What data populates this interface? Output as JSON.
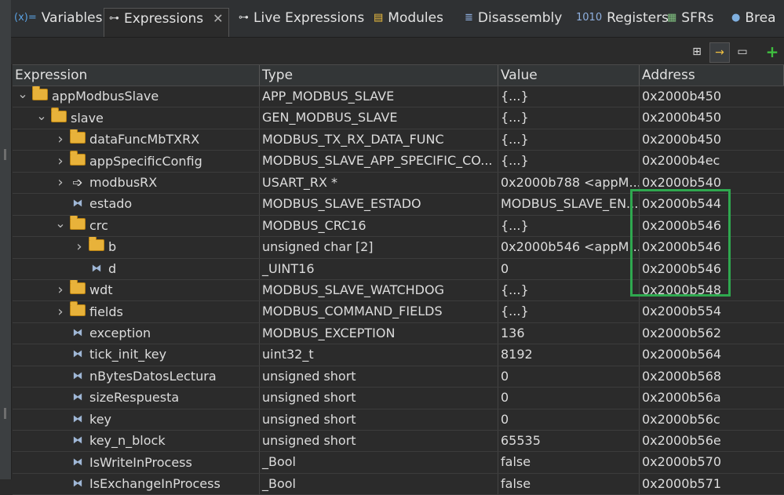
{
  "tabs": [
    {
      "icon": "variables-icon",
      "glyph": "(x)=",
      "label": "Variables",
      "active": false
    },
    {
      "icon": "expressions-icon",
      "glyph": "⊶",
      "label": "Expressions",
      "active": true
    },
    {
      "icon": "live-expressions-icon",
      "glyph": "⊶",
      "label": "Live Expressions",
      "active": false
    },
    {
      "icon": "modules-icon",
      "glyph": "▤",
      "label": "Modules",
      "active": false
    },
    {
      "icon": "disassembly-icon",
      "glyph": "≣",
      "label": "Disassembly",
      "active": false
    },
    {
      "icon": "registers-icon",
      "glyph": "1010",
      "label": "Registers",
      "active": false
    },
    {
      "icon": "sfrs-icon",
      "glyph": "▦",
      "label": "SFRs",
      "active": false
    },
    {
      "icon": "breakpoints-icon",
      "glyph": "●",
      "label": "Brea",
      "active": false
    }
  ],
  "tab_close_glyph": "✕",
  "columns": [
    "Expression",
    "Type",
    "Value",
    "Address"
  ],
  "rows": [
    {
      "indent": 0,
      "twisty": "open",
      "icon": "folder",
      "name": "appModbusSlave",
      "type": "APP_MODBUS_SLAVE",
      "value": "{...}",
      "address": "0x2000b450"
    },
    {
      "indent": 1,
      "twisty": "open",
      "icon": "folder",
      "name": "slave",
      "type": "GEN_MODBUS_SLAVE",
      "value": "{...}",
      "address": "0x2000b450"
    },
    {
      "indent": 2,
      "twisty": "closed",
      "icon": "folder",
      "name": "dataFuncMbTXRX",
      "type": "MODBUS_TX_RX_DATA_FUNC",
      "value": "{...}",
      "address": "0x2000b450"
    },
    {
      "indent": 2,
      "twisty": "closed",
      "icon": "folder",
      "name": "appSpecificConfig",
      "type": "MODBUS_SLAVE_APP_SPECIFIC_CO...",
      "value": "{...}",
      "address": "0x2000b4ec"
    },
    {
      "indent": 2,
      "twisty": "closed",
      "icon": "pointer",
      "name": "modbusRX",
      "type": "USART_RX *",
      "value": "0x2000b788 <appM...",
      "address": "0x2000b540"
    },
    {
      "indent": 2,
      "twisty": "none",
      "icon": "var",
      "name": "estado",
      "type": "MODBUS_SLAVE_ESTADO",
      "value": "MODBUS_SLAVE_EN...",
      "address": "0x2000b544"
    },
    {
      "indent": 2,
      "twisty": "open",
      "icon": "folder",
      "name": "crc",
      "type": "MODBUS_CRC16",
      "value": "{...}",
      "address": "0x2000b546"
    },
    {
      "indent": 3,
      "twisty": "closed",
      "icon": "folder",
      "name": "b",
      "type": "unsigned char [2]",
      "value": "0x2000b546 <appM...",
      "address": "0x2000b546"
    },
    {
      "indent": 3,
      "twisty": "none",
      "icon": "var",
      "name": "d",
      "type": "_UINT16",
      "value": "0",
      "address": "0x2000b546"
    },
    {
      "indent": 2,
      "twisty": "closed",
      "icon": "folder",
      "name": "wdt",
      "type": "MODBUS_SLAVE_WATCHDOG",
      "value": "{...}",
      "address": "0x2000b548"
    },
    {
      "indent": 2,
      "twisty": "closed",
      "icon": "folder",
      "name": "fields",
      "type": "MODBUS_COMMAND_FIELDS",
      "value": "{...}",
      "address": "0x2000b554"
    },
    {
      "indent": 2,
      "twisty": "none",
      "icon": "var",
      "name": "exception",
      "type": "MODBUS_EXCEPTION",
      "value": "136",
      "address": "0x2000b562"
    },
    {
      "indent": 2,
      "twisty": "none",
      "icon": "var",
      "name": "tick_init_key",
      "type": "uint32_t",
      "value": "8192",
      "address": "0x2000b564"
    },
    {
      "indent": 2,
      "twisty": "none",
      "icon": "var",
      "name": "nBytesDatosLectura",
      "type": "unsigned short",
      "value": "0",
      "address": "0x2000b568"
    },
    {
      "indent": 2,
      "twisty": "none",
      "icon": "var",
      "name": "sizeRespuesta",
      "type": "unsigned short",
      "value": "0",
      "address": "0x2000b56a"
    },
    {
      "indent": 2,
      "twisty": "none",
      "icon": "var",
      "name": "key",
      "type": "unsigned short",
      "value": "0",
      "address": "0x2000b56c"
    },
    {
      "indent": 2,
      "twisty": "none",
      "icon": "var",
      "name": "key_n_block",
      "type": "unsigned short",
      "value": "65535",
      "address": "0x2000b56e"
    },
    {
      "indent": 2,
      "twisty": "none",
      "icon": "var",
      "name": "IsWriteInProcess",
      "type": "_Bool",
      "value": "false",
      "address": "0x2000b570"
    },
    {
      "indent": 2,
      "twisty": "none",
      "icon": "var",
      "name": "IsExchangeInProcess",
      "type": "_Bool",
      "value": "false",
      "address": "0x2000b571"
    }
  ],
  "colors": {
    "highlight": "#2fa84f",
    "folder": "#e8b23a",
    "background": "#2b2b2b"
  }
}
